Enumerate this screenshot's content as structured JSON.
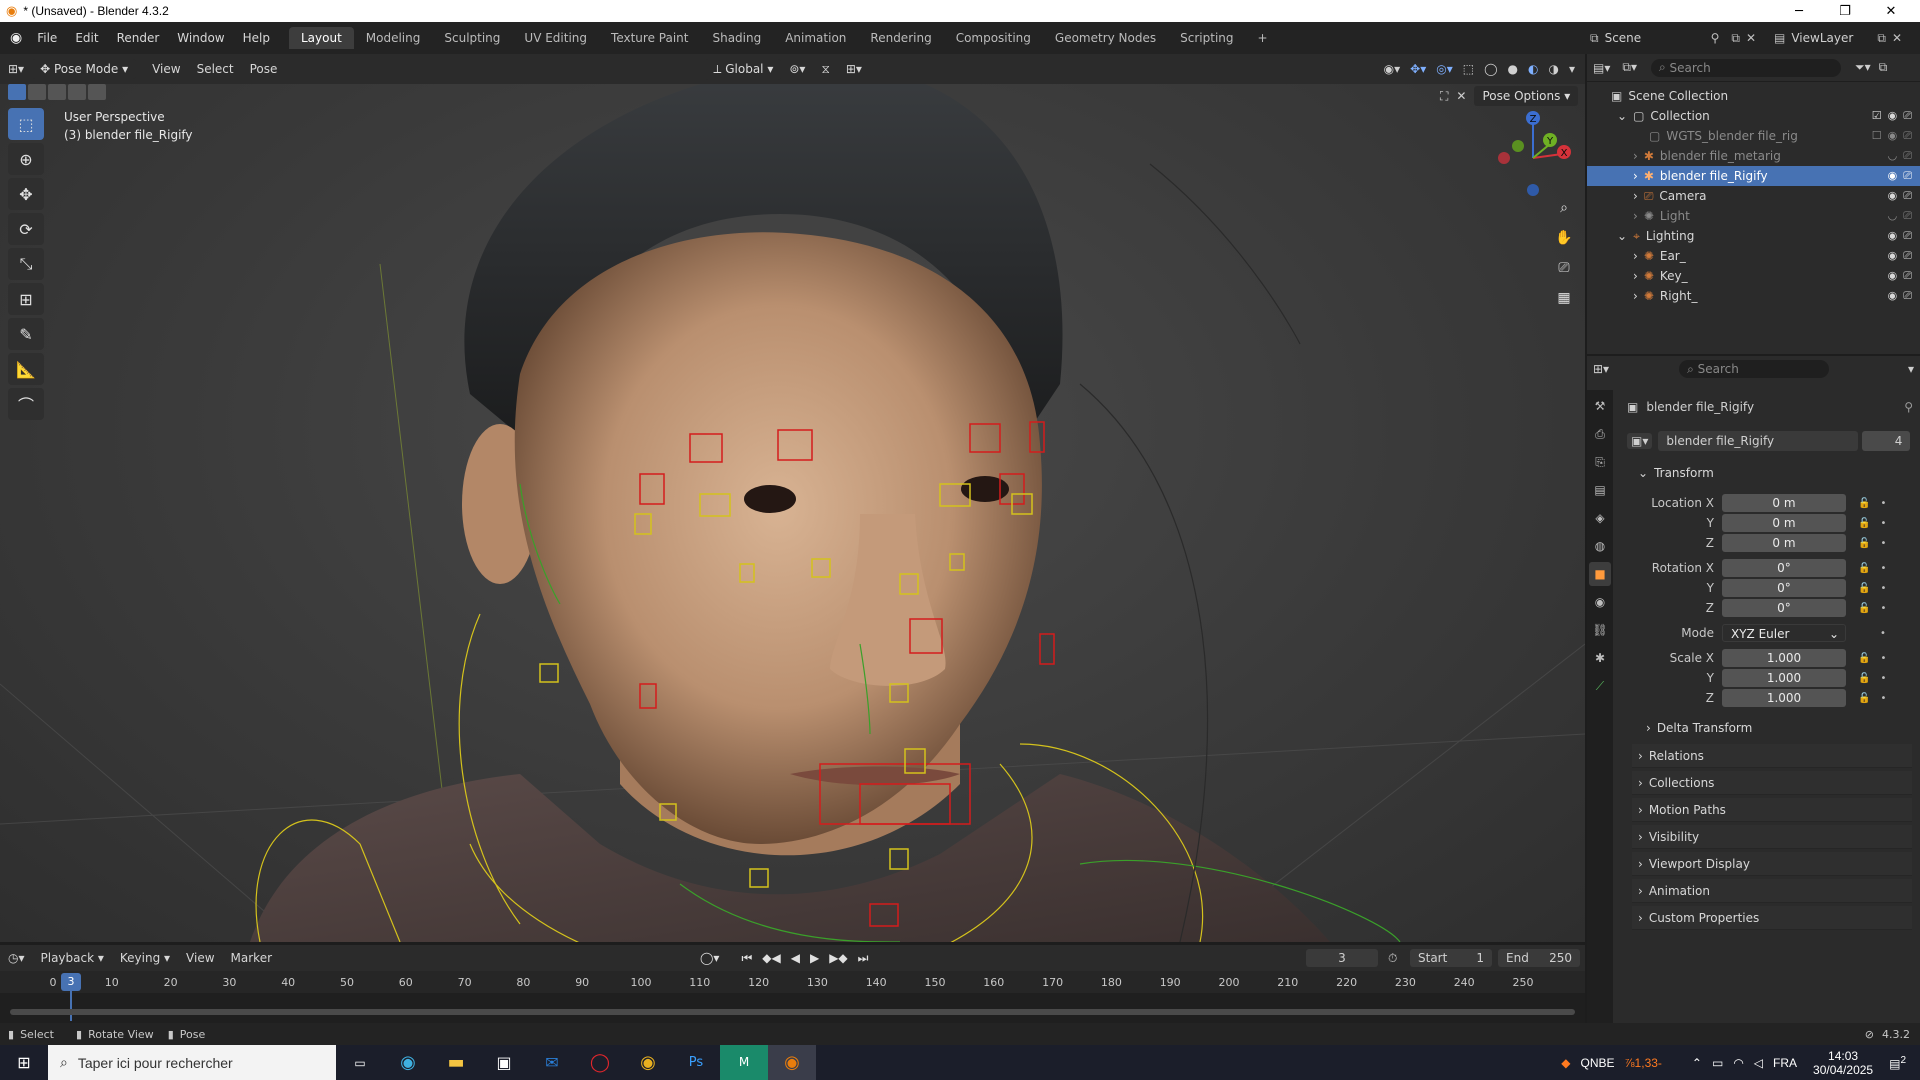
{
  "window": {
    "title": "* (Unsaved) - Blender 4.3.2",
    "controls": [
      "─",
      "❐",
      "✕"
    ]
  },
  "menu": [
    "File",
    "Edit",
    "Render",
    "Window",
    "Help"
  ],
  "workspaces": [
    "Layout",
    "Modeling",
    "Sculpting",
    "UV Editing",
    "Texture Paint",
    "Shading",
    "Animation",
    "Rendering",
    "Compositing",
    "Geometry Nodes",
    "Scripting",
    "+"
  ],
  "scene": {
    "scene_name": "Scene",
    "view_layer": "ViewLayer"
  },
  "viewport_header": {
    "mode": "Pose Mode",
    "menus": [
      "View",
      "Select",
      "Pose"
    ],
    "transform": "Global",
    "pose_options": "Pose Options"
  },
  "viewport": {
    "perspective": "User Perspective",
    "object_label": "(3) blender file_Rigify"
  },
  "gizmo": {
    "z": "Z",
    "y": "Y",
    "x": "X"
  },
  "outliner": {
    "search_placeholder": "Search",
    "rows": [
      {
        "label": "Scene Collection"
      },
      {
        "label": "Collection"
      },
      {
        "label": "WGTS_blender file_rig"
      },
      {
        "label": "blender file_metarig"
      },
      {
        "label": "blender file_Rigify"
      },
      {
        "label": "Camera"
      },
      {
        "label": "Light"
      },
      {
        "label": "Lighting"
      },
      {
        "label": "Ear_"
      },
      {
        "label": "Key_"
      },
      {
        "label": "Right_"
      }
    ]
  },
  "properties": {
    "search_placeholder": "Search",
    "object_name": "blender file_Rigify",
    "datablock_name": "blender file_Rigify",
    "user_count": "4",
    "transform_label": "Transform",
    "location": {
      "label": "Location X",
      "x": "0 m",
      "y": "0 m",
      "z": "0 m"
    },
    "rotation": {
      "label": "Rotation X",
      "x": "0°",
      "y": "0°",
      "z": "0°"
    },
    "mode": {
      "label": "Mode",
      "value": "XYZ Euler"
    },
    "scale": {
      "label": "Scale X",
      "x": "1.000",
      "y": "1.000",
      "z": "1.000"
    },
    "axis_y": "Y",
    "axis_z": "Z",
    "delta_transform": "Delta Transform",
    "sections": [
      "Relations",
      "Collections",
      "Motion Paths",
      "Visibility",
      "Viewport Display",
      "Animation",
      "Custom Properties"
    ]
  },
  "timeline": {
    "menus": [
      "Playback",
      "Keying",
      "View",
      "Marker"
    ],
    "current_frame": "3",
    "start_label": "Start",
    "start": "1",
    "end_label": "End",
    "end": "250",
    "ticks": [
      "0",
      "10",
      "20",
      "30",
      "40",
      "50",
      "60",
      "70",
      "80",
      "90",
      "100",
      "110",
      "120",
      "130",
      "140",
      "150",
      "160",
      "170",
      "180",
      "190",
      "200",
      "210",
      "220",
      "230",
      "240",
      "250"
    ],
    "playhead_label": "3"
  },
  "statusbar": {
    "select": "Select",
    "rotate": "Rotate View",
    "pose": "Pose",
    "version": "4.3.2"
  },
  "taskbar": {
    "search_placeholder": "Taper ici pour rechercher",
    "weather": "QNBE",
    "weather_value": "⅞1,33-",
    "lang": "FRA",
    "time": "14:03",
    "date": "30/04/2025",
    "notifications": "2"
  }
}
